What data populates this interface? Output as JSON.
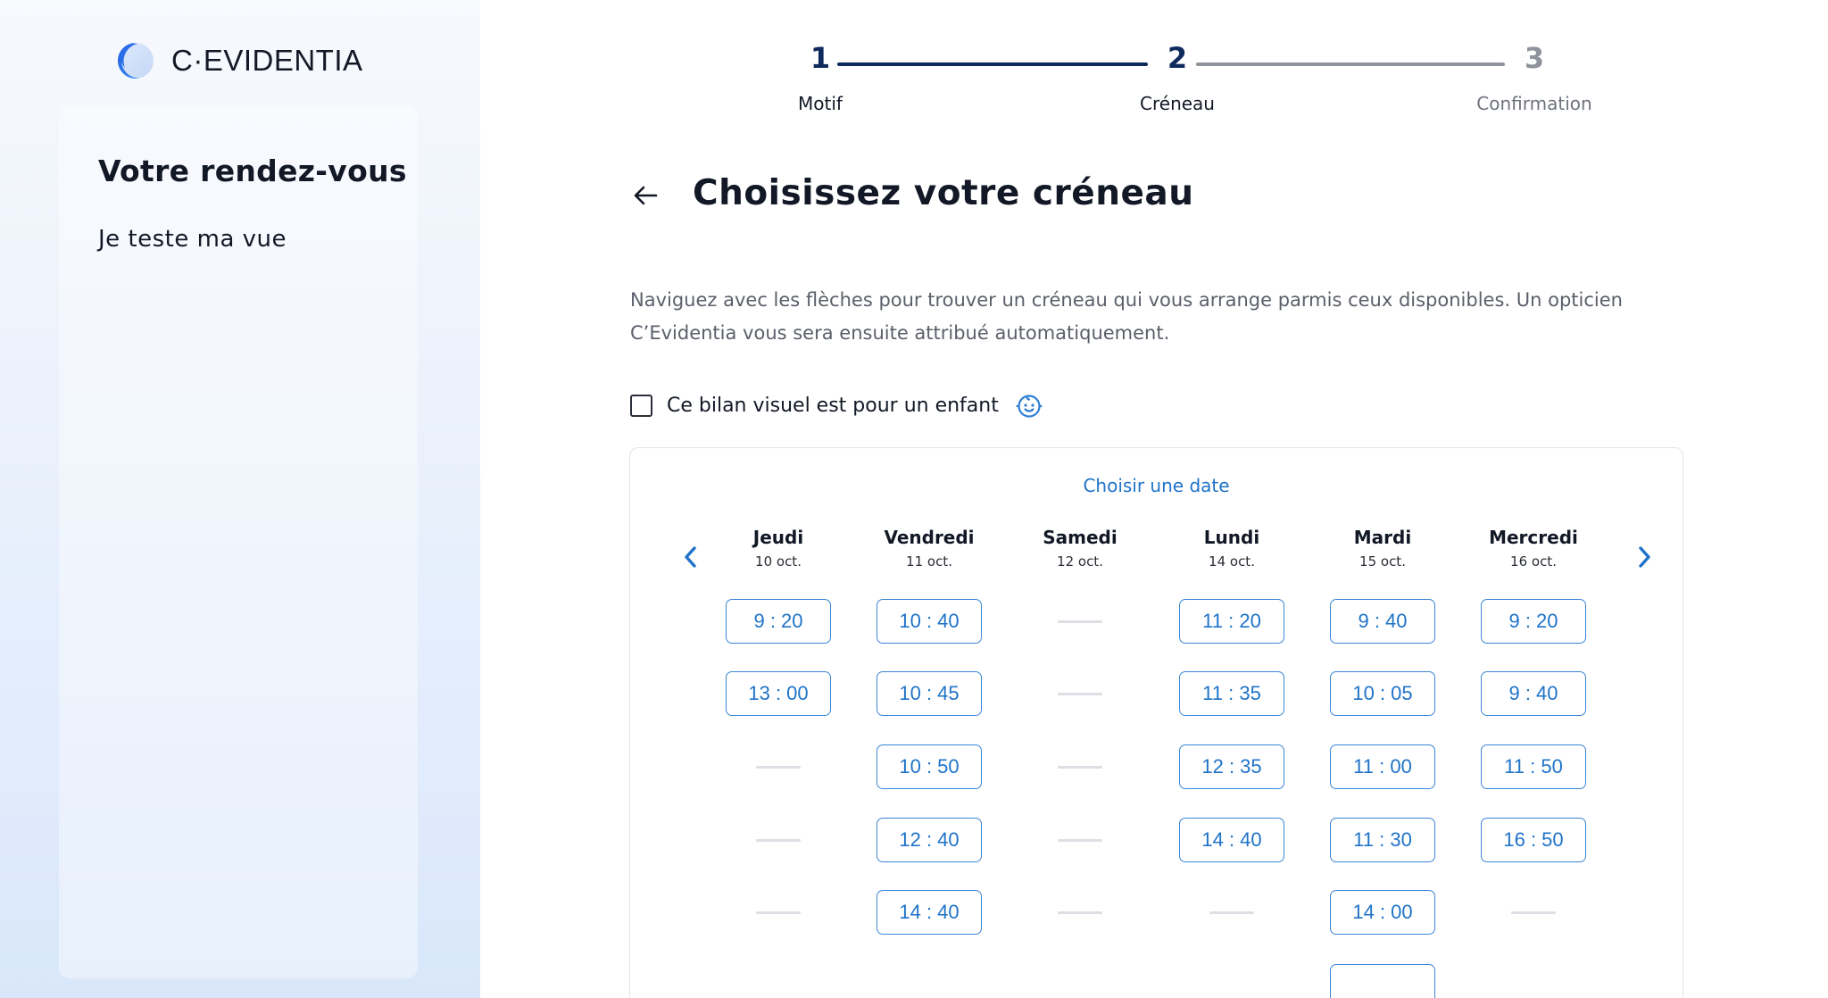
{
  "brand": {
    "logo_text": "C·EVIDENTIA"
  },
  "summary": {
    "title": "Votre rendez-vous",
    "item": "Je teste ma vue"
  },
  "stepper": {
    "steps": [
      {
        "number": "1",
        "label": "Motif",
        "state": "done"
      },
      {
        "number": "2",
        "label": "Créneau",
        "state": "active"
      },
      {
        "number": "3",
        "label": "Confirmation",
        "state": "upcoming"
      }
    ]
  },
  "main": {
    "title": "Choisissez votre créneau",
    "intro": "Naviguez avec les flèches pour trouver un créneau qui vous arrange parmis ceux disponibles. Un opticien C’Evidentia vous sera ensuite attribué automatiquement.",
    "child_checkbox_label": "Ce bilan visuel est pour un enfant",
    "child_checkbox_checked": false
  },
  "calendar": {
    "heading": "Choisir une date",
    "days": [
      {
        "name": "Jeudi",
        "date": "10 oct.",
        "slots": [
          "9 : 20",
          "13 : 00",
          null,
          null,
          null
        ]
      },
      {
        "name": "Vendredi",
        "date": "11 oct.",
        "slots": [
          "10 : 40",
          "10 : 45",
          "10 : 50",
          "12 : 40",
          "14 : 40"
        ]
      },
      {
        "name": "Samedi",
        "date": "12 oct.",
        "slots": [
          null,
          null,
          null,
          null,
          null
        ]
      },
      {
        "name": "Lundi",
        "date": "14 oct.",
        "slots": [
          "11 : 20",
          "11 : 35",
          "12 : 35",
          "14 : 40",
          null
        ]
      },
      {
        "name": "Mardi",
        "date": "15 oct.",
        "slots": [
          "9 : 40",
          "10 : 05",
          "11 : 00",
          "11 : 30",
          "14 : 00"
        ]
      },
      {
        "name": "Mercredi",
        "date": "16 oct.",
        "slots": [
          "9 : 20",
          "9 : 40",
          "11 : 50",
          "16 : 50",
          null
        ]
      }
    ]
  },
  "colors": {
    "accent": "#1f73c8",
    "step_done": "#0f2a5c",
    "step_upcoming": "#8f949c",
    "text_dark": "#121826"
  }
}
